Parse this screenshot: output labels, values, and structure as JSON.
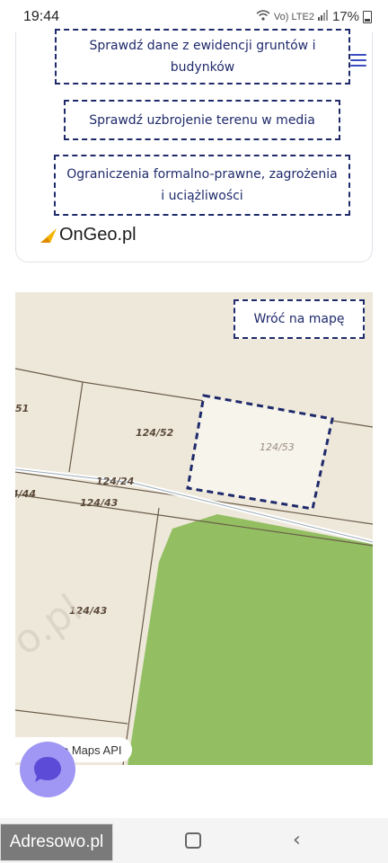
{
  "status_bar": {
    "time": "19:44",
    "network": "Vo) LTE2",
    "battery": "17%"
  },
  "card": {
    "buttons": [
      "Sprawdź dane z ewidencji gruntów i budynków",
      "Sprawdź uzbrojenie terenu w media",
      "Ograniczenia formalno-prawne, zagrożenia i uciążliwości"
    ],
    "logo_text": "OnGeo.pl",
    "menu_icon": "hamburger-icon"
  },
  "map": {
    "back_button": "Wróć na mapę",
    "parcel_labels": [
      "51",
      "124/52",
      "124/53",
      "124/24",
      "4/44",
      "124/43",
      "124/43"
    ],
    "watermark_text": "o.pl",
    "attribution": "o Maps API",
    "colors": {
      "selected_parcel_border": "#1f2a6b",
      "vegetation": "#8fbf5e",
      "parcel_lines": "#5a4a3a"
    }
  },
  "chat_button_icon": "chat-bubble-icon",
  "bottom": {
    "watermark": "Adresowo.pl",
    "home_icon": "home-icon",
    "back_icon": "back-chevron-icon",
    "back_glyph": "‹"
  }
}
